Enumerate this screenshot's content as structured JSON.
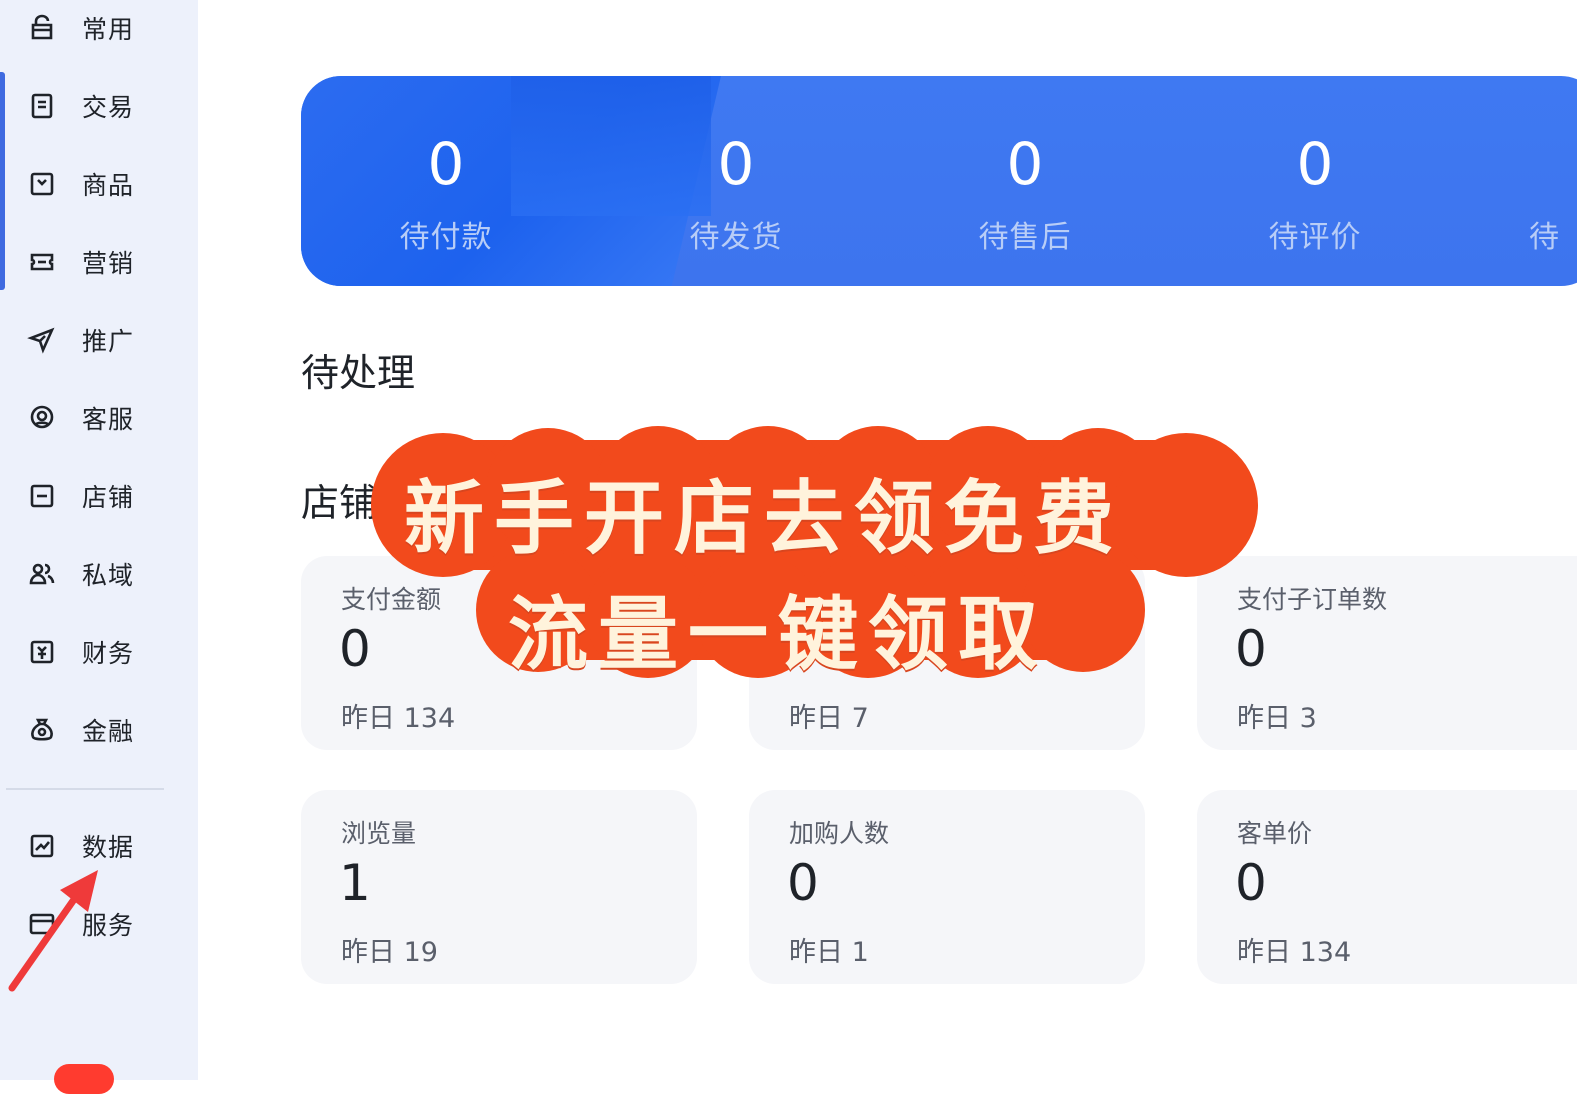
{
  "sidebar": {
    "items": [
      {
        "label": "常用",
        "icon": "shop-bag-icon"
      },
      {
        "label": "交易",
        "icon": "order-doc-icon"
      },
      {
        "label": "商品",
        "icon": "product-box-icon"
      },
      {
        "label": "营销",
        "icon": "coupon-ticket-icon"
      },
      {
        "label": "推广",
        "icon": "send-plane-icon"
      },
      {
        "label": "客服",
        "icon": "headset-icon"
      },
      {
        "label": "店铺",
        "icon": "store-icon"
      },
      {
        "label": "私域",
        "icon": "users-icon"
      },
      {
        "label": "财务",
        "icon": "finance-yen-icon"
      },
      {
        "label": "金融",
        "icon": "money-bag-icon"
      },
      {
        "label": "数据",
        "icon": "chart-icon"
      },
      {
        "label": "服务",
        "icon": "service-card-icon"
      }
    ]
  },
  "banner": {
    "stats": [
      {
        "value": "0",
        "label": "待付款"
      },
      {
        "value": "0",
        "label": "待发货"
      },
      {
        "value": "0",
        "label": "待售后"
      },
      {
        "value": "0",
        "label": "待评价"
      },
      {
        "value": "",
        "label": "待"
      }
    ]
  },
  "sections": {
    "pending_title": "待处理",
    "store_title": "店铺"
  },
  "cards": [
    {
      "label": "支付金额",
      "value": "0",
      "prev": "昨日 134"
    },
    {
      "label": "",
      "value": "",
      "prev": "昨日 7"
    },
    {
      "label": "支付子订单数",
      "value": "0",
      "prev": "昨日 3"
    },
    {
      "label": "浏览量",
      "value": "1",
      "prev": "昨日 19"
    },
    {
      "label": "加购人数",
      "value": "0",
      "prev": "昨日 1"
    },
    {
      "label": "客单价",
      "value": "0",
      "prev": "昨日 134"
    }
  ],
  "promo": {
    "line1": "新手开店去领免费",
    "line2": "流量一键领取",
    "bg_color": "#f24a1c",
    "text_color": "#fff3dc"
  },
  "colors": {
    "sidebar_bg": "#edf1fb",
    "accent": "#3f6ae0",
    "banner": "#3d74ee",
    "annotation_arrow": "#ef3a3a"
  }
}
